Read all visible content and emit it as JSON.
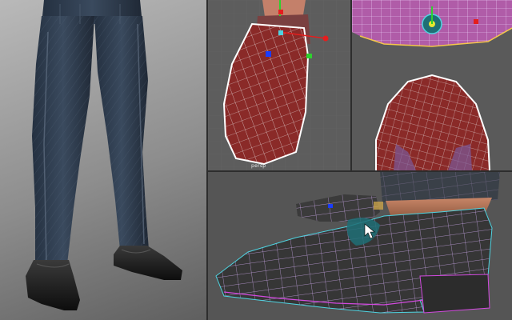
{
  "viewport_top_mid": {
    "label": "persp"
  },
  "colors": {
    "mesh_red": "#8a2a28",
    "wire_white": "#f0f0f0",
    "wire_cyan": "#4fd3e0",
    "wire_magenta": "#d24adf",
    "gizmo_red": "#e41e1e",
    "gizmo_green": "#2ed12e",
    "gizmo_blue": "#1a3cff",
    "viewport_bg": "#5d5d5d",
    "render_bg": "#a0a0a0"
  },
  "icons": {
    "move_gizmo": "move-gizmo-icon",
    "cursor": "mouse-cursor-icon"
  }
}
